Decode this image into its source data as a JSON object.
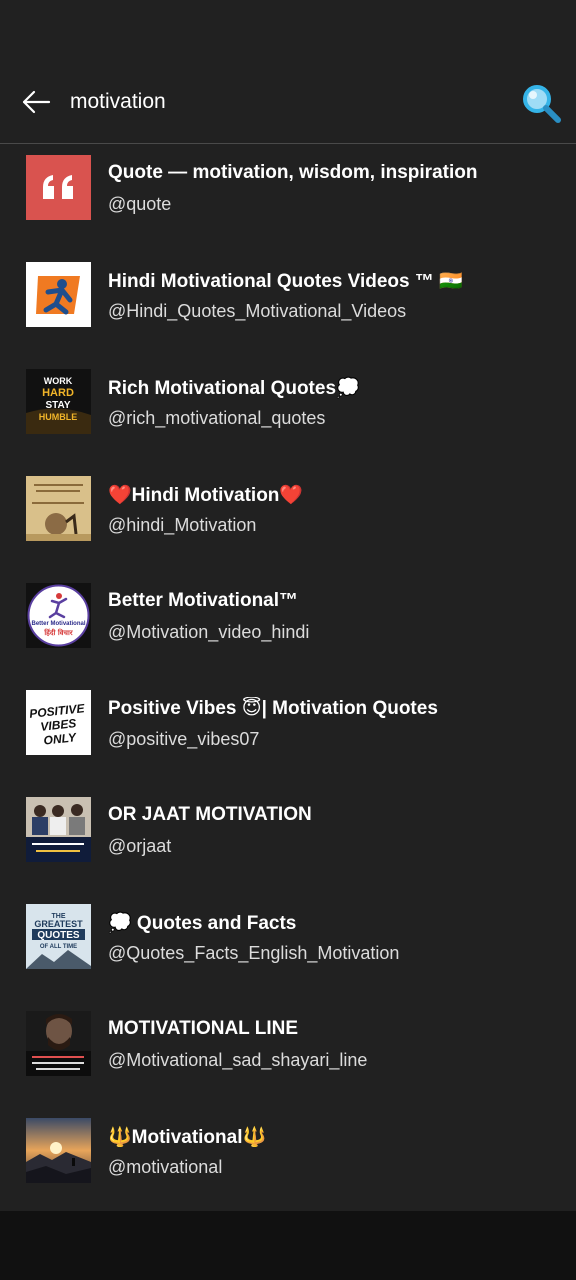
{
  "search": {
    "query": "motivation"
  },
  "icons": {
    "back": "arrow-left-icon",
    "search": "magnifier-icon"
  },
  "colors": {
    "background": "#212121",
    "divider": "#4a4a4a",
    "search_icon": "#35b4e8",
    "nav_bar": "#111111"
  },
  "results": [
    {
      "title": "Quote — motivation, wisdom, inspiration",
      "handle": "@quote"
    },
    {
      "title": "Hindi Motivational Quotes Videos ™ 🇮🇳",
      "handle": "@Hindi_Quotes_Motivational_Videos"
    },
    {
      "title": "Rich Motivational Quotes💭",
      "handle": "@rich_motivational_quotes"
    },
    {
      "title": "❤️Hindi Motivation❤️",
      "handle": "@hindi_Motivation"
    },
    {
      "title": "Better Motivational™",
      "handle": "@Motivation_video_hindi"
    },
    {
      "title": "Positive Vibes 😇| Motivation Quotes",
      "handle": "@positive_vibes07"
    },
    {
      "title": "OR JAAT MOTIVATION",
      "handle": "@orjaat"
    },
    {
      "title": "💭 Quotes and Facts",
      "handle": "@Quotes_Facts_English_Motivation"
    },
    {
      "title": "MOTIVATIONAL LINE",
      "handle": "@Motivational_sad_shayari_line"
    },
    {
      "title": "🔱Motivational🔱",
      "handle": "@motivational"
    }
  ],
  "avatar_texts": {
    "rich": [
      "WORK",
      "HARD",
      "STAY",
      "HUMBLE"
    ],
    "better": [
      "Better Motivational",
      "हिंदी विचार"
    ],
    "positive": [
      "POSITIVE",
      "VIBES",
      "ONLY"
    ],
    "greatest": [
      "THE",
      "GREATEST",
      "QUOTES",
      "OF ALL TIME"
    ]
  }
}
